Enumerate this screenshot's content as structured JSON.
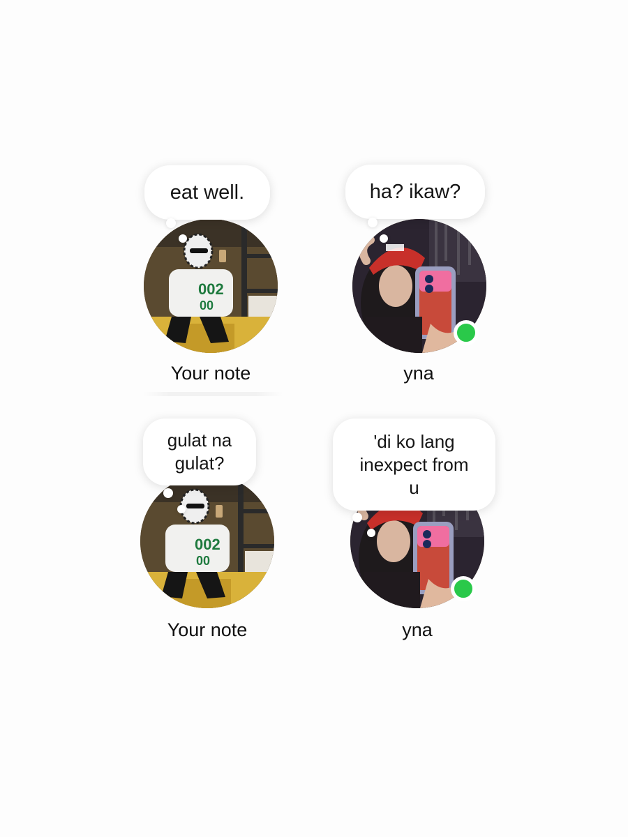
{
  "notes": [
    {
      "text": "eat well.",
      "name": "Your note",
      "online": false,
      "photo": "selfie-man"
    },
    {
      "text": "ha? ikaw?",
      "name": "yna",
      "online": true,
      "photo": "selfie-woman"
    },
    {
      "text": "gulat na\ngulat?",
      "name": "Your note",
      "online": false,
      "photo": "selfie-man"
    },
    {
      "text": "'di ko lang\ninexpect from\nu",
      "name": "yna",
      "online": true,
      "photo": "selfie-woman"
    }
  ],
  "colors": {
    "background": "#fdfdfd",
    "bubble": "#ffffff",
    "online": "#2ac94a",
    "text": "#151515"
  }
}
